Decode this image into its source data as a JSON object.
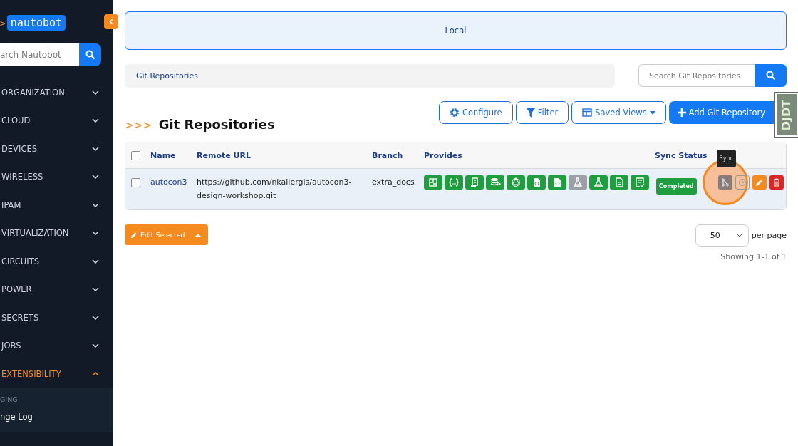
{
  "sidebar": {
    "logo_prefix": ">",
    "logo": "nautobot",
    "search": {
      "placeholder": "arch Nautobot"
    },
    "items": [
      {
        "label": "ORGANIZATION",
        "expanded": false
      },
      {
        "label": "CLOUD",
        "expanded": false
      },
      {
        "label": "DEVICES",
        "expanded": false
      },
      {
        "label": "WIRELESS",
        "expanded": false
      },
      {
        "label": "IPAM",
        "expanded": false
      },
      {
        "label": "VIRTUALIZATION",
        "expanded": false
      },
      {
        "label": "CIRCUITS",
        "expanded": false
      },
      {
        "label": "POWER",
        "expanded": false
      },
      {
        "label": "SECRETS",
        "expanded": false
      },
      {
        "label": "JOBS",
        "expanded": false
      },
      {
        "label": "EXTENSIBILITY",
        "expanded": true,
        "children": [
          {
            "kind": "header",
            "label": "GING"
          },
          {
            "kind": "link",
            "label": "nge Log"
          }
        ]
      }
    ]
  },
  "banner": "Local",
  "breadcrumb": "Git Repositories",
  "search": {
    "placeholder": "Search Git Repositories"
  },
  "toolbar": {
    "buttons": [
      {
        "kind": "configure",
        "label": "Configure"
      },
      {
        "kind": "filter",
        "label": "Filter"
      },
      {
        "kind": "saved-views",
        "label": "Saved Views"
      },
      {
        "kind": "add",
        "label": "Add Git Repository"
      }
    ]
  },
  "debug_tab": "DJDT",
  "page_title_prefix": ">>>",
  "page_title": "Git Repositories",
  "table": {
    "select_all": false,
    "columns": [
      "Name",
      "Remote URL",
      "Branch",
      "Provides",
      "Sync Status"
    ],
    "rows": [
      {
        "selected": false,
        "name": "autocon3",
        "remote_url": "https://github.com/nkallergis/autocon3-design-workshop.git",
        "branch": "extra_docs",
        "provides": [
          {
            "kind": "config",
            "enabled": true
          },
          {
            "kind": "json",
            "enabled": true
          },
          {
            "kind": "scroll",
            "enabled": true
          },
          {
            "kind": "database",
            "enabled": true
          },
          {
            "kind": "graphql",
            "enabled": true
          },
          {
            "kind": "code",
            "enabled": true
          },
          {
            "kind": "code",
            "enabled": true
          },
          {
            "kind": "flask",
            "enabled": false
          },
          {
            "kind": "flask",
            "enabled": true
          },
          {
            "kind": "doc",
            "enabled": true
          },
          {
            "kind": "checklist",
            "enabled": true
          }
        ],
        "sync_status": "Completed",
        "sync_highlighted": true,
        "tooltip": "Sync"
      }
    ]
  },
  "edit_selected": "Edit Selected",
  "pagination": {
    "per_page_value": "50",
    "per_page_label": "per page",
    "showing": "Showing 1-1 of 1"
  }
}
